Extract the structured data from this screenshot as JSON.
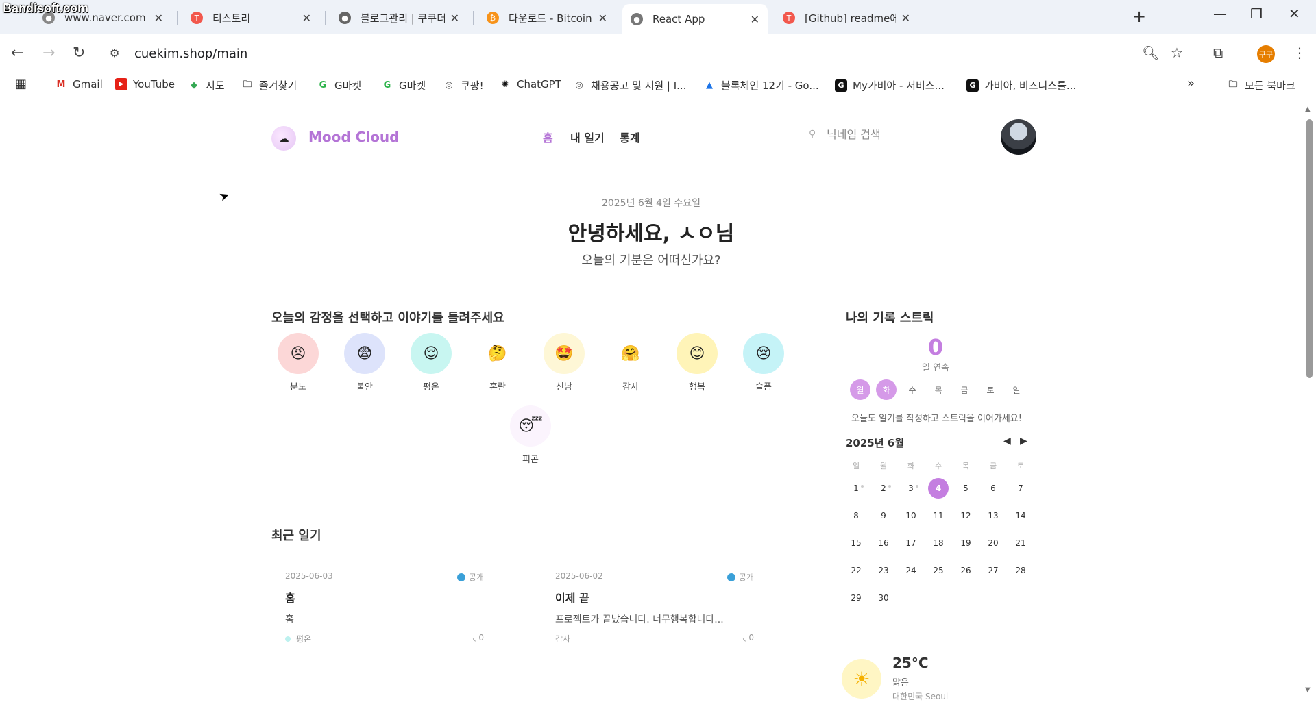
{
  "watermark": "Bandisoft.com",
  "tabs": [
    {
      "title": "www.naver.com",
      "active": false
    },
    {
      "title": "티스토리",
      "active": false
    },
    {
      "title": "블로그관리 | 쿠쿠더님의 블로그",
      "active": false
    },
    {
      "title": "다운로드 - Bitcoin",
      "active": false
    },
    {
      "title": "React App",
      "active": true
    },
    {
      "title": "[Github] readme에 화면 캡처",
      "active": false
    }
  ],
  "address_bar": {
    "url": "cuekim.shop/main"
  },
  "profile_label": "쿠쿠",
  "bookmarks": [
    "Gmail",
    "YouTube",
    "지도",
    "즐겨찾기",
    "G마켓",
    "G마켓",
    "쿠팡!",
    "ChatGPT",
    "채용공고 및 지원 | I...",
    "블록체인 12기 - Go...",
    "My가비아 - 서비스...",
    "가비아, 비즈니스를...",
    "모든 북마크"
  ],
  "app": {
    "brand": "Mood Cloud",
    "nav": [
      "홈",
      "내 일기",
      "통계"
    ],
    "search_placeholder": "닉네임 검색"
  },
  "hero": {
    "date": "2025년 6월 4일 수요일",
    "greeting": "안녕하세요, ㅅㅇ님",
    "question": "오늘의 기분은 어떠신가요?"
  },
  "emotions": {
    "title": "오늘의 감정을 선택하고 이야기를 들려주세요",
    "items": [
      {
        "label": "분노",
        "icon": "😠",
        "bg": "#fcd7d7"
      },
      {
        "label": "불안",
        "icon": "😨",
        "bg": "#dde3fb"
      },
      {
        "label": "평온",
        "icon": "😌",
        "bg": "#c8f6f1"
      },
      {
        "label": "혼란",
        "icon": "🤔",
        "bg": "#ffffff"
      },
      {
        "label": "신남",
        "icon": "🤩",
        "bg": "#fef7d6"
      },
      {
        "label": "감사",
        "icon": "🤗",
        "bg": "#ffffff"
      },
      {
        "label": "행복",
        "icon": "😊",
        "bg": "#fff4b8"
      },
      {
        "label": "슬픔",
        "icon": "😢",
        "bg": "#c5f3f7"
      },
      {
        "label": "피곤",
        "icon": "😴",
        "bg": "#fbf4fd"
      }
    ]
  },
  "recent": {
    "title": "최근 일기",
    "entries": [
      {
        "date": "2025-06-03",
        "visibility": "공개",
        "title": "홈",
        "content": "홈",
        "mood": "평온",
        "comments": "0"
      },
      {
        "date": "2025-06-02",
        "visibility": "공개",
        "title": "이제 끝",
        "content": "프로젝트가 끝났습니다. 너무행복합니다...",
        "mood": "감사",
        "comments": "0"
      }
    ]
  },
  "streak": {
    "title": "나의 기록 스트릭",
    "count": "0",
    "unit": "일 연속",
    "weekdays": [
      {
        "label": "월",
        "on": true
      },
      {
        "label": "화",
        "on": true
      },
      {
        "label": "수",
        "on": false
      },
      {
        "label": "목",
        "on": false
      },
      {
        "label": "금",
        "on": false
      },
      {
        "label": "토",
        "on": false
      },
      {
        "label": "일",
        "on": false
      }
    ],
    "message": "오늘도 일기를 작성하고 스트릭을 이어가세요!"
  },
  "calendar": {
    "title": "2025년 6월",
    "headers": [
      "일",
      "월",
      "화",
      "수",
      "목",
      "금",
      "토"
    ],
    "days": [
      "1",
      "2",
      "3",
      "4",
      "5",
      "6",
      "7",
      "8",
      "9",
      "10",
      "11",
      "12",
      "13",
      "14",
      "15",
      "16",
      "17",
      "18",
      "19",
      "20",
      "21",
      "22",
      "23",
      "24",
      "25",
      "26",
      "27",
      "28",
      "29",
      "30"
    ],
    "today": "4",
    "marked": [
      "1",
      "2",
      "3"
    ]
  },
  "weather": {
    "temperature": "25°C",
    "description": "맑음",
    "location": "대한민국 Seoul"
  }
}
